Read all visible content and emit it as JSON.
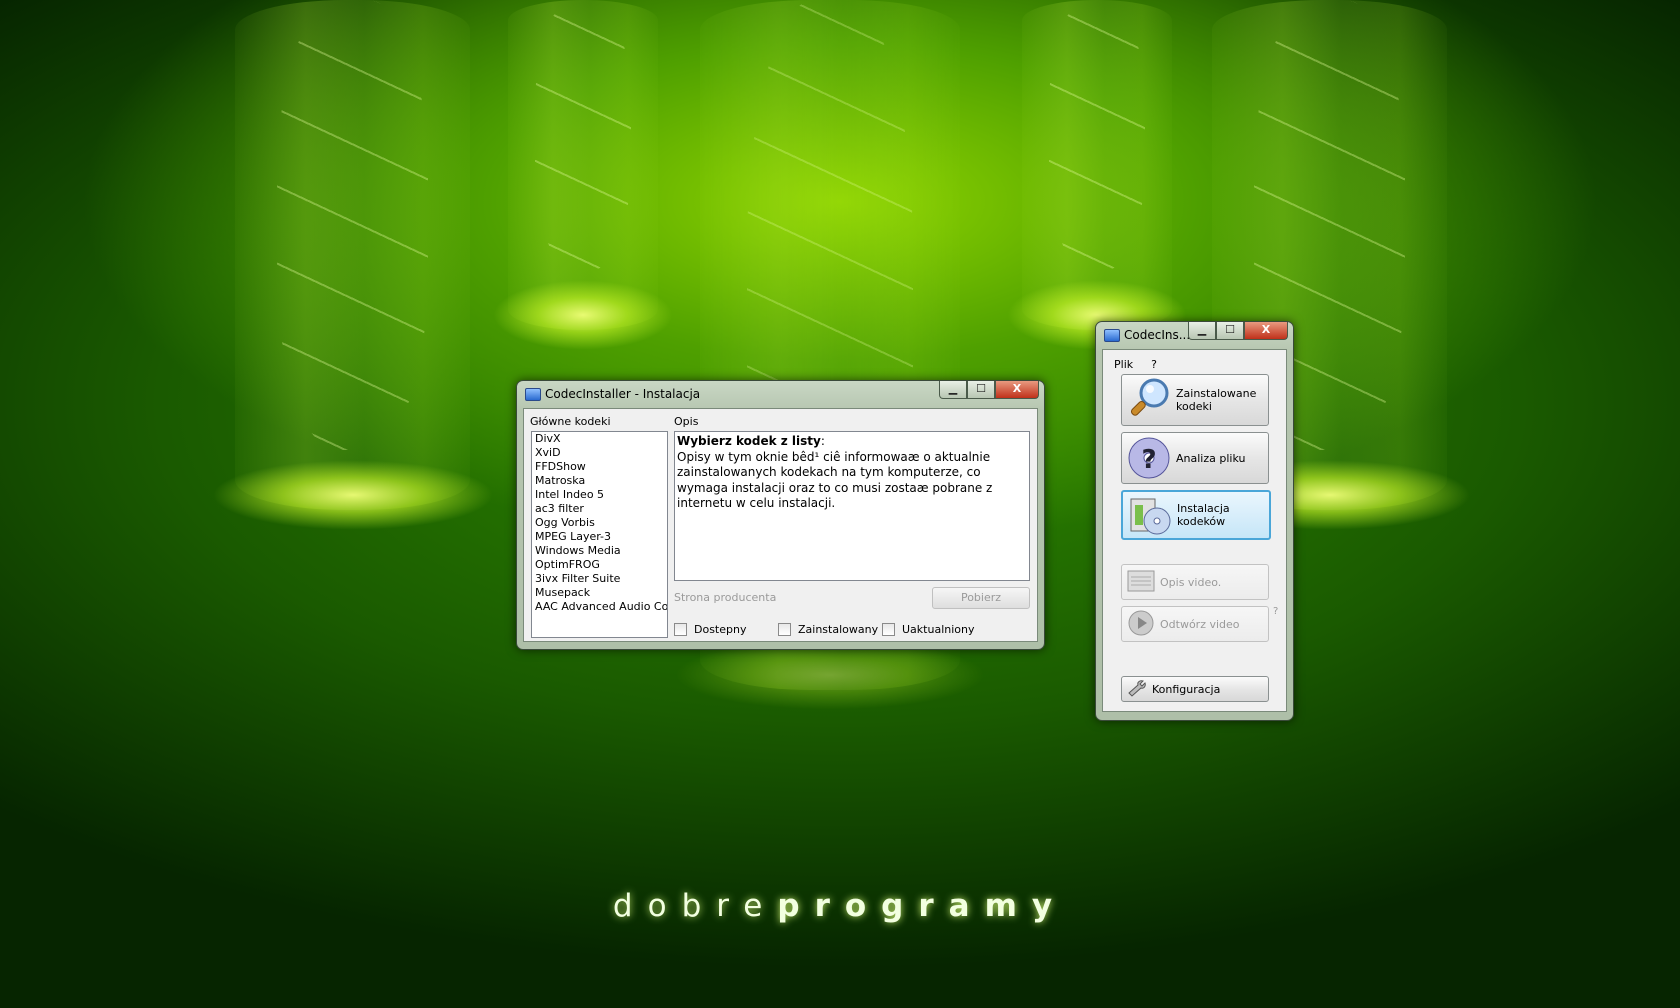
{
  "wallpaper": {
    "brand_light": "dobre",
    "brand_bold": "programy"
  },
  "install_window": {
    "title": "CodecInstaller - Instalacja",
    "codecs_label": "Główne kodeki",
    "codecs": [
      "DivX",
      "XviD",
      "FFDShow",
      "Matroska",
      "Intel Indeo 5",
      "ac3 filter",
      "Ogg Vorbis",
      "MPEG Layer-3",
      "Windows Media",
      "OptimFROG",
      "3ivx Filter Suite",
      "Musepack",
      "AAC  Advanced  Audio Co"
    ],
    "desc_label": "Opis",
    "desc_heading": "Wybierz kodek z listy",
    "desc_colon": ":",
    "desc_text": "Opisy w tym oknie bêd¹ ciê informowaæ o aktualnie zainstalowanych kodekach na tym komputerze, co wymaga instalacji oraz to co musi zostaæ pobrane z internetu w celu instalacji.",
    "vendor_link": "Strona producenta",
    "download_button": "Pobierz",
    "checkboxes": [
      "Dostepny",
      "Zainstalowany",
      "Uaktualniony"
    ]
  },
  "main_window": {
    "title": "CodecIns...",
    "menu": [
      "Plik",
      "?"
    ],
    "buttons": {
      "installed": "Zainstalowane kodeki",
      "analyze": "Analiza pliku",
      "install": "Instalacja kodeków",
      "video_desc": "Opis video.",
      "open_video": "Odtwórz video",
      "config": "Konfiguracja"
    },
    "side_mark": "?"
  },
  "window_controls": {
    "minimize": "▁",
    "maximize": "☐",
    "close": "X"
  }
}
